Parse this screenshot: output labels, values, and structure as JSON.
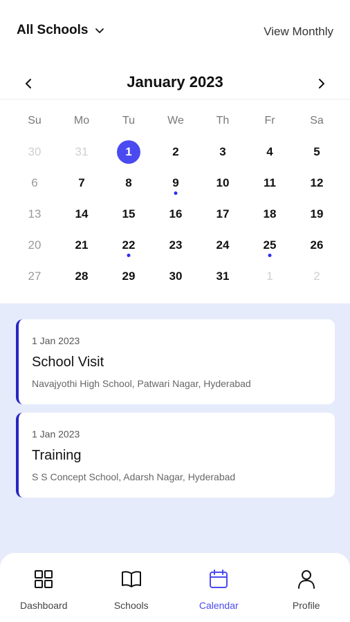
{
  "header": {
    "school_filter": "All Schools",
    "view_toggle": "View Monthly"
  },
  "calendar": {
    "month_title": "January 2023",
    "weekdays": [
      "Su",
      "Mo",
      "Tu",
      "We",
      "Th",
      "Fr",
      "Sa"
    ],
    "weeks": [
      [
        {
          "d": "30",
          "state": "muted"
        },
        {
          "d": "31",
          "state": "muted"
        },
        {
          "d": "1",
          "state": "selected"
        },
        {
          "d": "2"
        },
        {
          "d": "3"
        },
        {
          "d": "4"
        },
        {
          "d": "5"
        }
      ],
      [
        {
          "d": "6",
          "state": "sunday"
        },
        {
          "d": "7"
        },
        {
          "d": "8"
        },
        {
          "d": "9",
          "dot": true
        },
        {
          "d": "10"
        },
        {
          "d": "11"
        },
        {
          "d": "12"
        }
      ],
      [
        {
          "d": "13",
          "state": "sunday"
        },
        {
          "d": "14"
        },
        {
          "d": "15"
        },
        {
          "d": "16"
        },
        {
          "d": "17"
        },
        {
          "d": "18"
        },
        {
          "d": "19"
        }
      ],
      [
        {
          "d": "20",
          "state": "sunday"
        },
        {
          "d": "21"
        },
        {
          "d": "22",
          "dot": true
        },
        {
          "d": "23"
        },
        {
          "d": "24"
        },
        {
          "d": "25",
          "dot": true
        },
        {
          "d": "26"
        }
      ],
      [
        {
          "d": "27",
          "state": "sunday"
        },
        {
          "d": "28"
        },
        {
          "d": "29"
        },
        {
          "d": "30"
        },
        {
          "d": "31"
        },
        {
          "d": "1",
          "state": "muted"
        },
        {
          "d": "2",
          "state": "muted"
        }
      ]
    ]
  },
  "events": [
    {
      "date": "1 Jan 2023",
      "title": "School Visit",
      "location": "Navajyothi High School, Patwari Nagar, Hyderabad"
    },
    {
      "date": "1 Jan 2023",
      "title": "Training",
      "location": "S S Concept School, Adarsh Nagar, Hyderabad"
    }
  ],
  "bottom_nav": [
    {
      "label": "Dashboard",
      "icon": "dashboard-icon",
      "active": false
    },
    {
      "label": "Schools",
      "icon": "book-icon",
      "active": false
    },
    {
      "label": "Calendar",
      "icon": "calendar-icon",
      "active": true
    },
    {
      "label": "Profile",
      "icon": "profile-icon",
      "active": false
    }
  ],
  "colors": {
    "accent": "#4a4af0",
    "event_bar": "#2525c4",
    "events_background": "#e6ebfb"
  }
}
